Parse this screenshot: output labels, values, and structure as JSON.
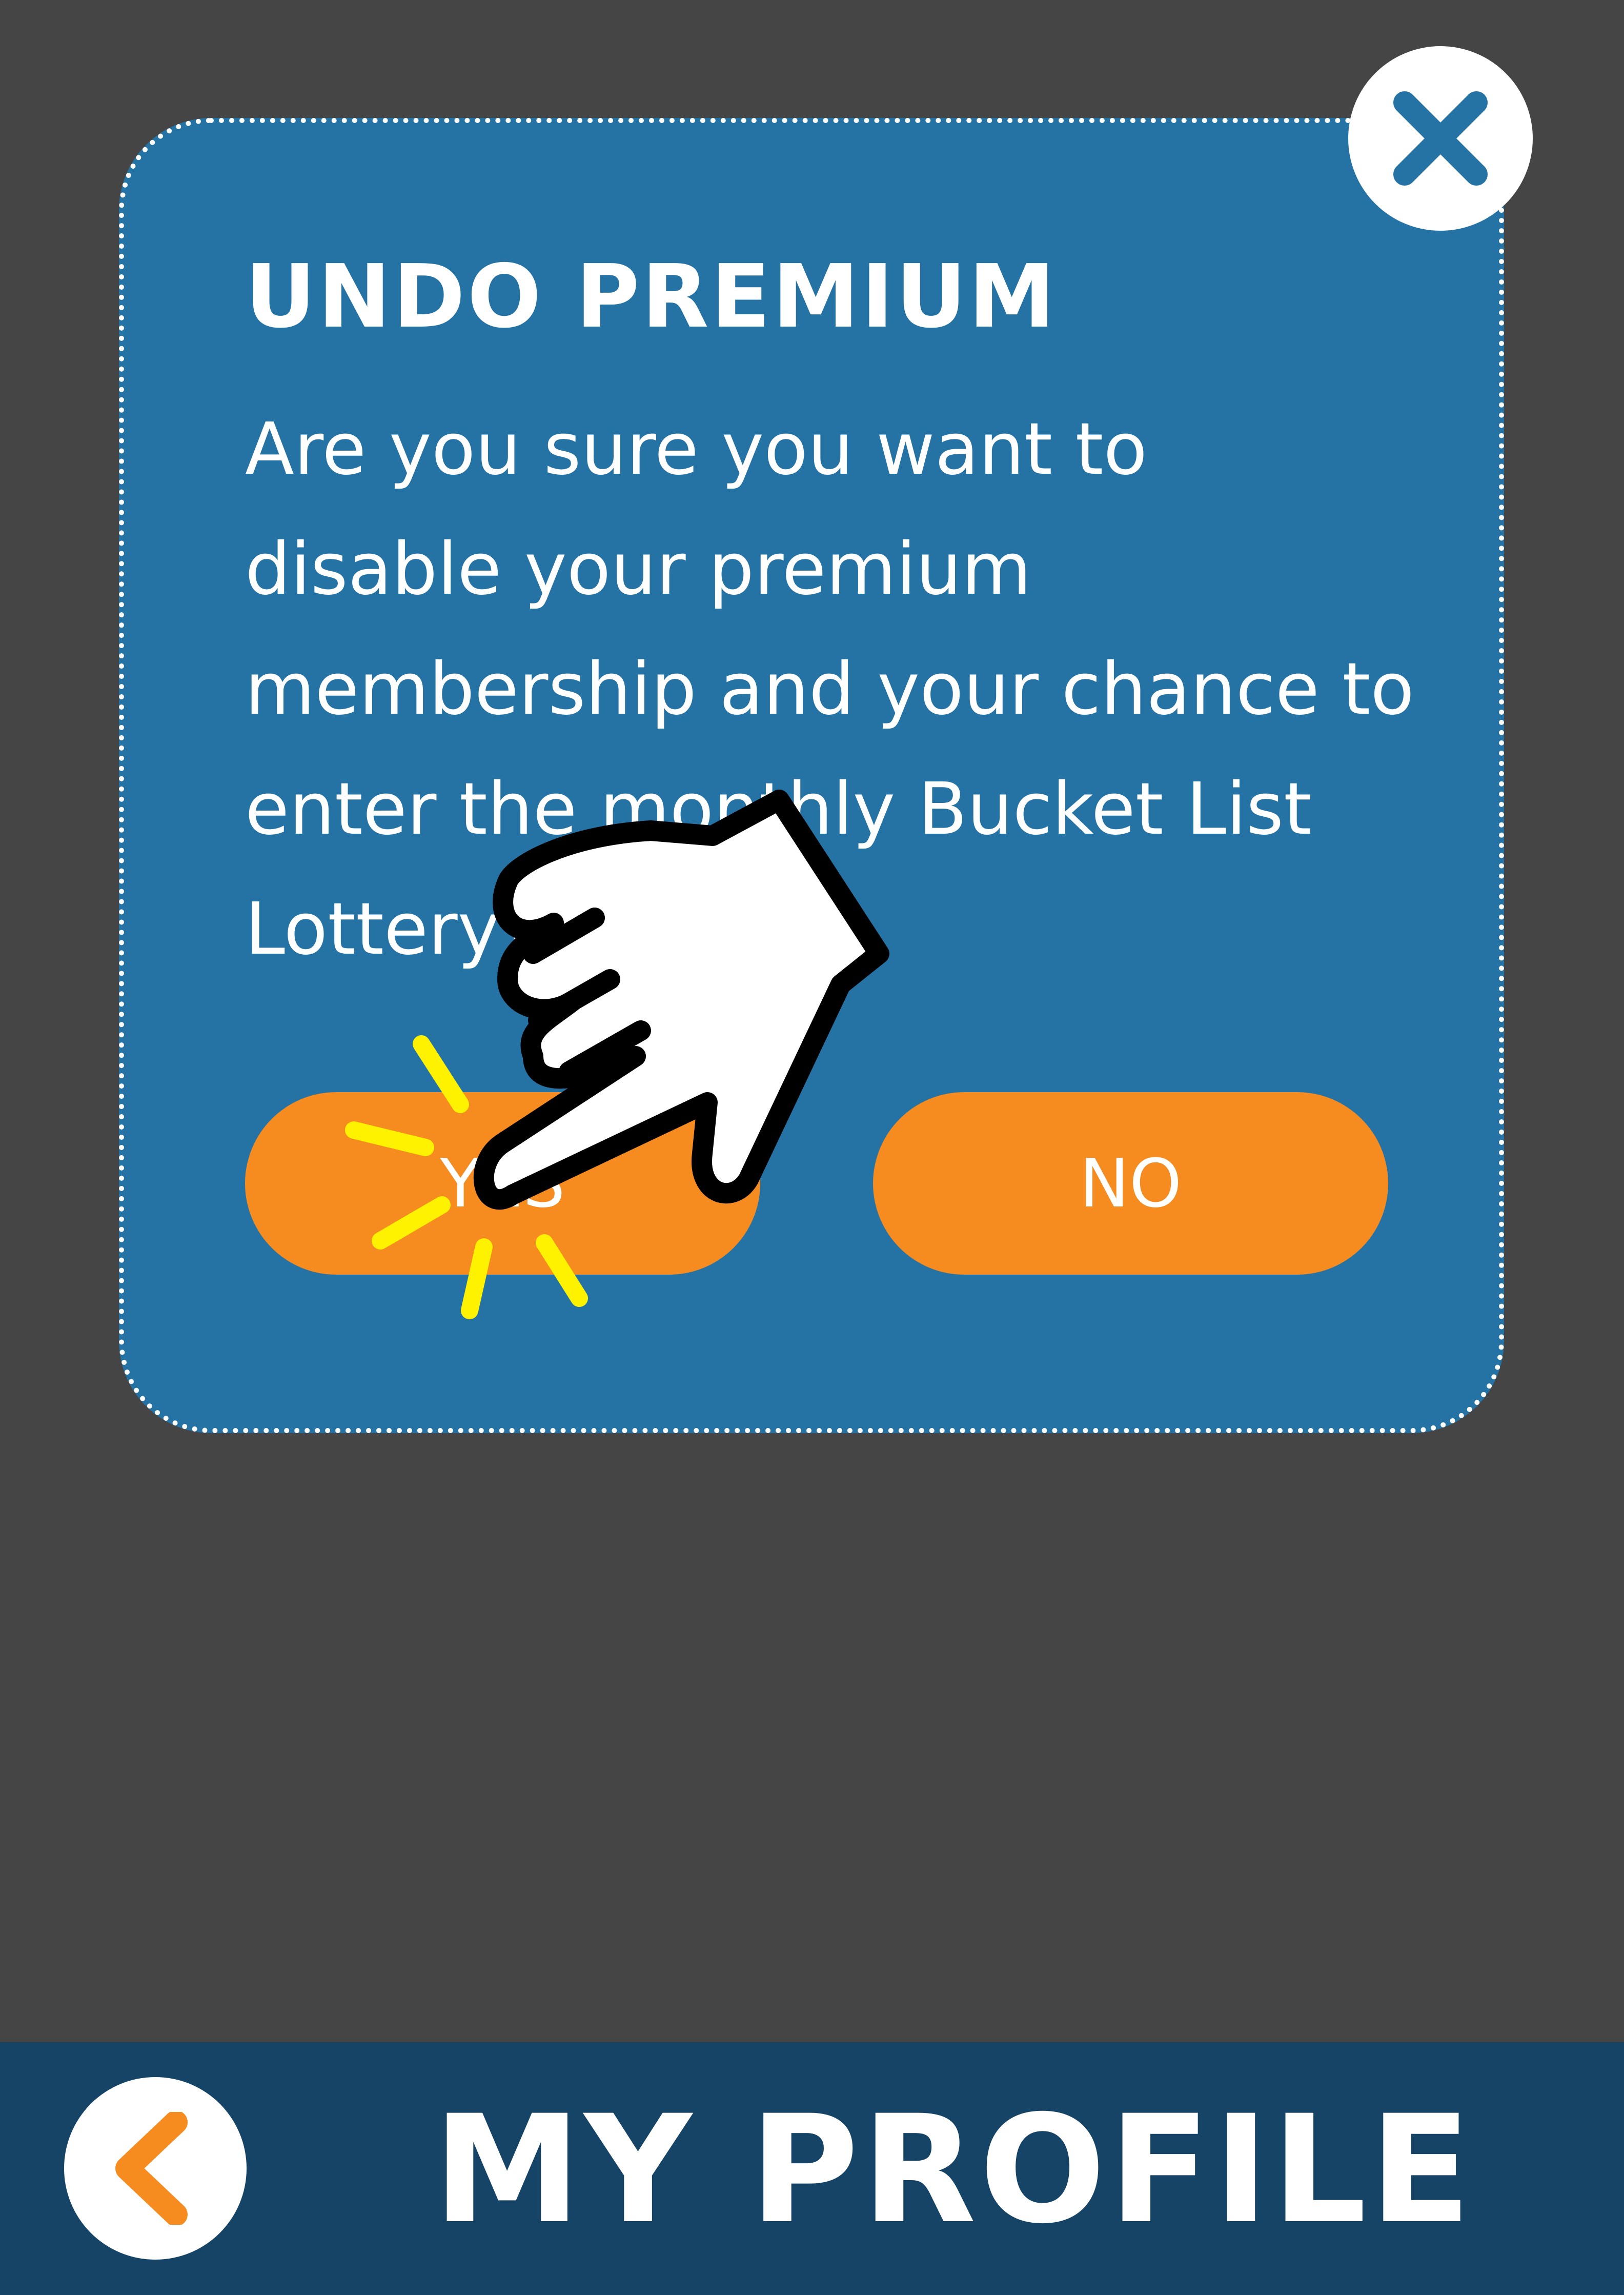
{
  "dialog": {
    "title": "UNDO PREMIUM",
    "message": "Are you sure you want to\ndisable your premium\nmembership and your chance to\nenter the monthly Bucket List\nLottery?",
    "yes_label": "YES",
    "no_label": "NO",
    "close_icon": "close-x-icon"
  },
  "header": {
    "title": "MY PROFILE",
    "back_icon": "chevron-left-icon"
  },
  "overlay": {
    "pointer_icon": "pointing-hand-icon",
    "tap_effect": "tap-burst"
  },
  "colors": {
    "background": "#454545",
    "dialog": "#2573a5",
    "button": "#f68b1f",
    "bar": "#164466",
    "text": "#ffffff",
    "accent_orange": "#f68b1f",
    "burst": "#fff200"
  }
}
